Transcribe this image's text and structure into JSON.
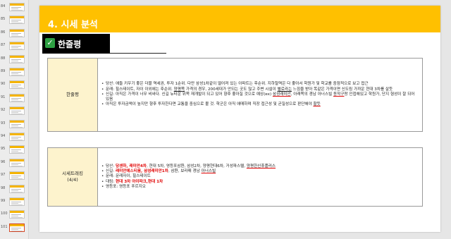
{
  "thumbnails": [
    "84",
    "85",
    "86",
    "87",
    "88",
    "89",
    "90",
    "91",
    "92",
    "93",
    "94",
    "95",
    "96",
    "97",
    "98",
    "99",
    "100",
    "101"
  ],
  "active_thumbnail_index": 17,
  "slide": {
    "title": "4. 시세 분석",
    "subtitle_check": "✓",
    "subtitle": "한줄평"
  },
  "review": {
    "label": "한줄평",
    "bullets": [
      {
        "segments": [
          {
            "text": "당산: 애들 키우기 좋은 더블 역세권, 투자 1순위. 다만 삼성1차같이 떨어져 있는 아파트는 후순위. 지하철역은 다 좋아서 학원가 및 학교를 중점적으로 보고 접근"
          }
        ]
      },
      {
        "segments": [
          {
            "text": "문래: 힐스테이트, 자이 이외에는 후순위. "
          },
          {
            "text": "양평쪽",
            "style": "ul"
          },
          {
            "text": " 가격의 경우, 200세대가 안되는 곳도 많고 주변 시설이 "
          },
          {
            "text": "별로라는",
            "style": "ul"
          },
          {
            "text": " 느낌을 받아 똑같은 가격이면 신도림 가까운 현대 3차를 살듯"
          }
        ]
      },
      {
        "segments": [
          {
            "text": "신길: 아직은 가격이 너무 비싸다. 신길 뉴타운 위쪽 재개발이 되고 있어 향후 좋아질 것으로 예상(ex) "
          },
          {
            "text": "삼성래미안",
            "style": "ulr"
          },
          {
            "text": ", 아래쪽의 경남 아너스빌 "
          },
          {
            "text": "동작구",
            "style": "ulr"
          },
          {
            "text": "랑 인접해있고 학원가, 단지 형성이 잘 되어있음"
          }
        ]
      },
      {
        "segments": [
          {
            "text": "아직은 투자금액이 높지만 향후 투자한다면 교통을 중심으로 볼 것. 학군은 아직 애매하며 직장 접근성 및 균질성으로 판단해야 "
          },
          {
            "text": "할듯",
            "style": "ulr"
          }
        ]
      }
    ]
  },
  "ranking": {
    "label_line1": "시세트래킹",
    "label_line2": "(4/4)",
    "bullets": [
      {
        "segments": [
          {
            "text": "당산: "
          },
          {
            "text": "당센하, 래미안4차",
            "style": "red"
          },
          {
            "text": ", 현대 5차, 영등포삼환, 삼성2차, 양평현대6차, 거성파스텔, "
          },
          {
            "text": "양평한신휴플러스",
            "style": "ulr"
          }
        ]
      },
      {
        "segments": [
          {
            "text": "신길: "
          },
          {
            "text": "래미안에스티움, 삼성래미안1차",
            "style": "red"
          },
          {
            "text": ", 삼환, 보라매 경남 "
          },
          {
            "text": "아너스빌",
            "style": "ulr"
          }
        ]
      },
      {
        "segments": [
          {
            "text": "문래: 문래자이, 힐스테이트"
          }
        ]
      },
      {
        "segments": [
          {
            "text": "대림: "
          },
          {
            "text": "현대 3차 아이파크,현대 1차",
            "style": "red"
          }
        ]
      },
      {
        "segments": [
          {
            "text": "영등포: 영등포 푸르지오"
          }
        ]
      }
    ]
  }
}
